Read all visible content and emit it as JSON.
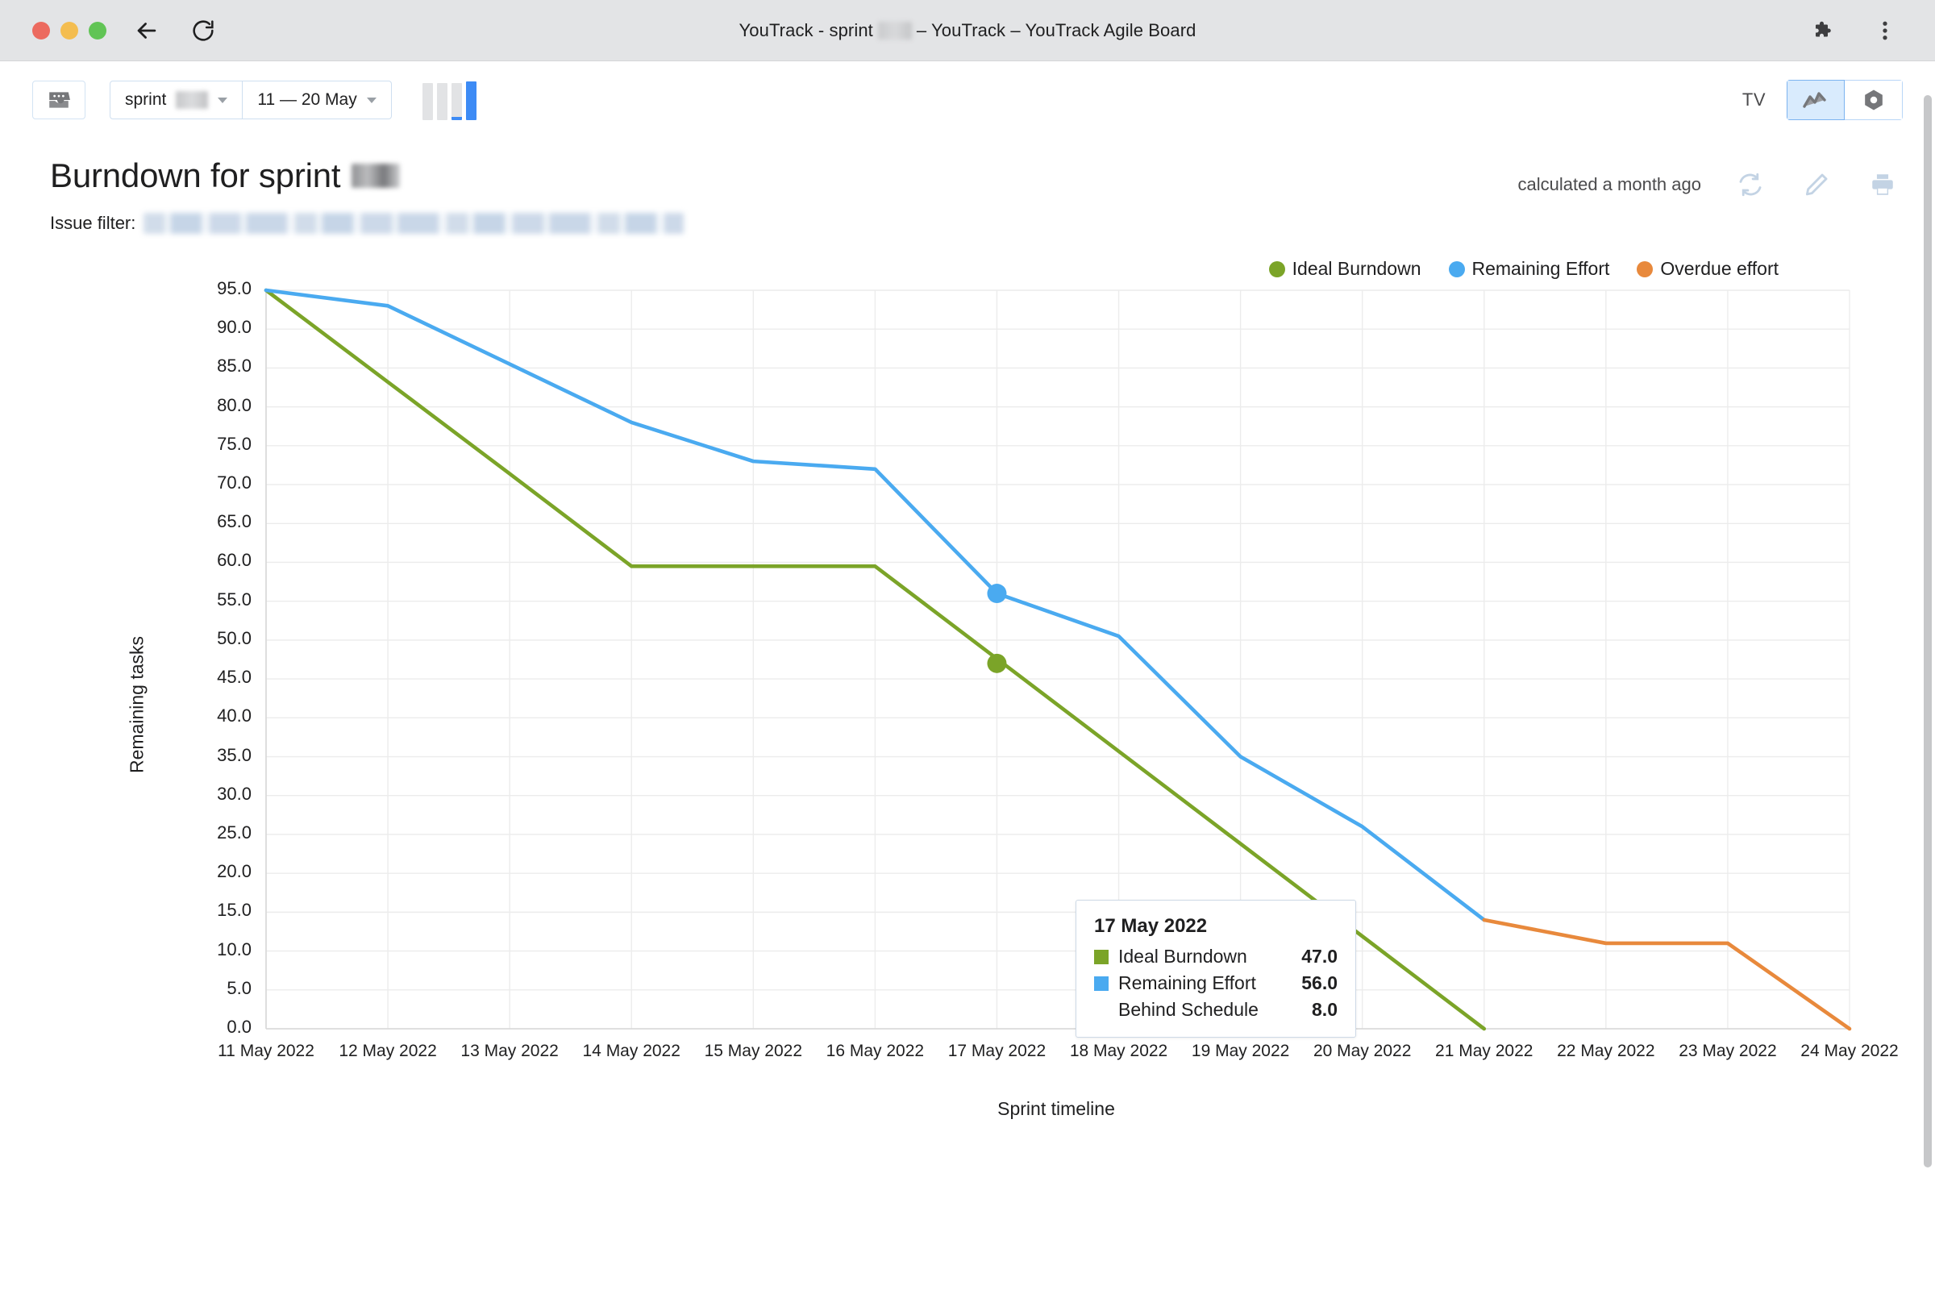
{
  "window": {
    "title_prefix": "YouTrack - sprint",
    "title_suffix": "– YouTrack – YouTrack Agile Board",
    "back_icon": "back-arrow-icon",
    "reload_icon": "reload-icon",
    "extensions_icon": "puzzle-piece-icon",
    "menu_icon": "kebab-menu-icon"
  },
  "toolbar": {
    "board_icon": "agile-board-icon",
    "sprint_label": "sprint",
    "date_range": "11 — 20 May",
    "sprint_progress_icon": "sprint-progress-bars",
    "tv_label": "TV",
    "chart_toggle_icon": "line-chart-icon",
    "settings_toggle_icon": "gear-icon"
  },
  "header": {
    "title_prefix": "Burndown for sprint",
    "calculated": "calculated a month ago",
    "refresh_icon": "refresh-icon",
    "edit_icon": "pencil-icon",
    "print_icon": "printer-icon",
    "issue_filter_label": "Issue filter:"
  },
  "chart_data": {
    "type": "line",
    "title": "Burndown for sprint",
    "xlabel": "Sprint timeline",
    "ylabel": "Remaining tasks",
    "ylim": [
      0,
      95
    ],
    "grid": true,
    "legend_position": "top-right",
    "categories": [
      "11 May 2022",
      "12 May 2022",
      "13 May 2022",
      "14 May 2022",
      "15 May 2022",
      "16 May 2022",
      "17 May 2022",
      "18 May 2022",
      "19 May 2022",
      "20 May 2022",
      "21 May 2022",
      "22 May 2022",
      "23 May 2022",
      "24 May 2022"
    ],
    "yticks": [
      "0.0",
      "5.0",
      "10.0",
      "15.0",
      "20.0",
      "25.0",
      "30.0",
      "35.0",
      "40.0",
      "45.0",
      "50.0",
      "55.0",
      "60.0",
      "65.0",
      "70.0",
      "75.0",
      "80.0",
      "85.0",
      "90.0",
      "95.0"
    ],
    "series": [
      {
        "name": "Ideal Burndown",
        "color": "#7ba428",
        "values": [
          95.0,
          83.2,
          71.4,
          59.5,
          59.5,
          59.5,
          47.6,
          35.7,
          23.8,
          11.9,
          0.0,
          null,
          null,
          null
        ]
      },
      {
        "name": "Remaining Effort",
        "color": "#4aaaf0",
        "values": [
          95.0,
          93.0,
          85.5,
          78.0,
          73.0,
          72.0,
          56.0,
          50.5,
          35.0,
          26.0,
          14.0,
          null,
          null,
          null
        ]
      },
      {
        "name": "Overdue effort",
        "color": "#e8893c",
        "values": [
          null,
          null,
          null,
          null,
          null,
          null,
          null,
          null,
          null,
          null,
          14.0,
          11.0,
          11.0,
          0.0
        ]
      }
    ],
    "highlight_point": {
      "x": "17 May 2022",
      "ideal": 47.0,
      "remaining": 56.0
    },
    "tooltip": {
      "date": "17 May 2022",
      "rows": [
        {
          "label": "Ideal Burndown",
          "value": "47.0",
          "color": "#7ba428"
        },
        {
          "label": "Remaining Effort",
          "value": "56.0",
          "color": "#4aaaf0"
        },
        {
          "label": "Behind Schedule",
          "value": "8.0",
          "color": null
        }
      ]
    }
  }
}
